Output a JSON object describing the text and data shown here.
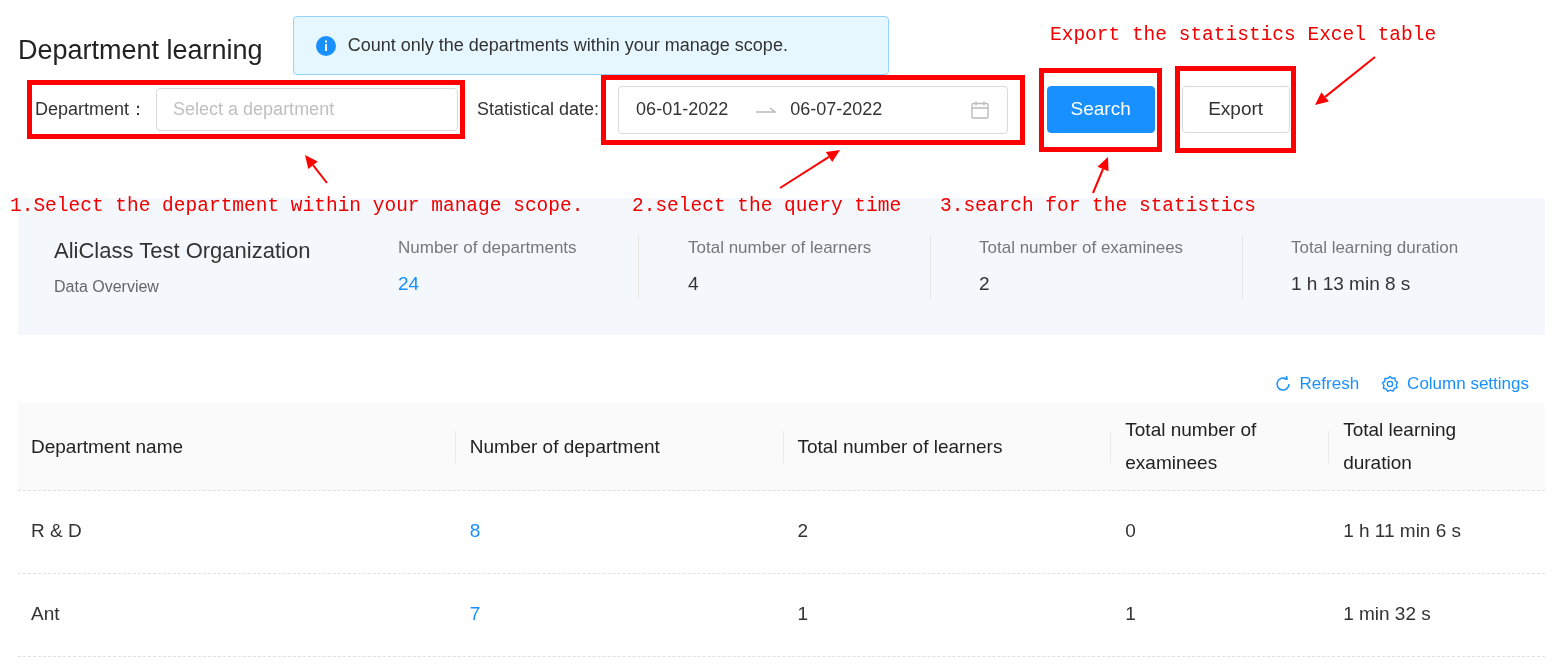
{
  "page": {
    "title": "Department learning"
  },
  "notice": {
    "text": "Count only the departments within your manage scope."
  },
  "filters": {
    "department": {
      "label": "Department：",
      "placeholder": "Select a department"
    },
    "date": {
      "label": "Statistical date:",
      "start": "06-01-2022",
      "end": "06-07-2022"
    }
  },
  "buttons": [
    {
      "label": "Search",
      "kind": "primary"
    },
    {
      "label": "Export",
      "kind": "default"
    }
  ],
  "annotations": [
    {
      "text": "1.Select the department within your manage scope."
    },
    {
      "text": "2.select the query time"
    },
    {
      "text": "3.search for the statistics"
    },
    {
      "text": "Export the statistics Excel table"
    }
  ],
  "overview": {
    "org": "AliClass Test Organization",
    "subtitle": "Data Overview",
    "stats": [
      {
        "label": "Number of departments",
        "value": "24",
        "link": true
      },
      {
        "label": "Total number of learners",
        "value": "4",
        "link": false
      },
      {
        "label": "Total number of examinees",
        "value": "2",
        "link": false
      },
      {
        "label": "Total learning duration",
        "value": "1 h 13 min 8 s",
        "link": false
      }
    ]
  },
  "toolbar": [
    {
      "label": "Refresh",
      "kind": "refresh"
    },
    {
      "label": "Column settings",
      "kind": "settings"
    }
  ],
  "table": {
    "columns": [
      {
        "label": "Department name",
        "kind": "text"
      },
      {
        "label": "Number of department",
        "kind": "link"
      },
      {
        "label": "Total number of learners",
        "kind": "text"
      },
      {
        "label": "Total number of examinees",
        "kind": "text"
      },
      {
        "label": "Total learning duration",
        "kind": "text"
      }
    ],
    "rows": [
      {
        "cells": [
          "R & D",
          "8",
          "2",
          "0",
          "1 h 11 min 6 s"
        ]
      },
      {
        "cells": [
          "Ant",
          "7",
          "1",
          "1",
          "1 min 32 s"
        ]
      }
    ]
  }
}
